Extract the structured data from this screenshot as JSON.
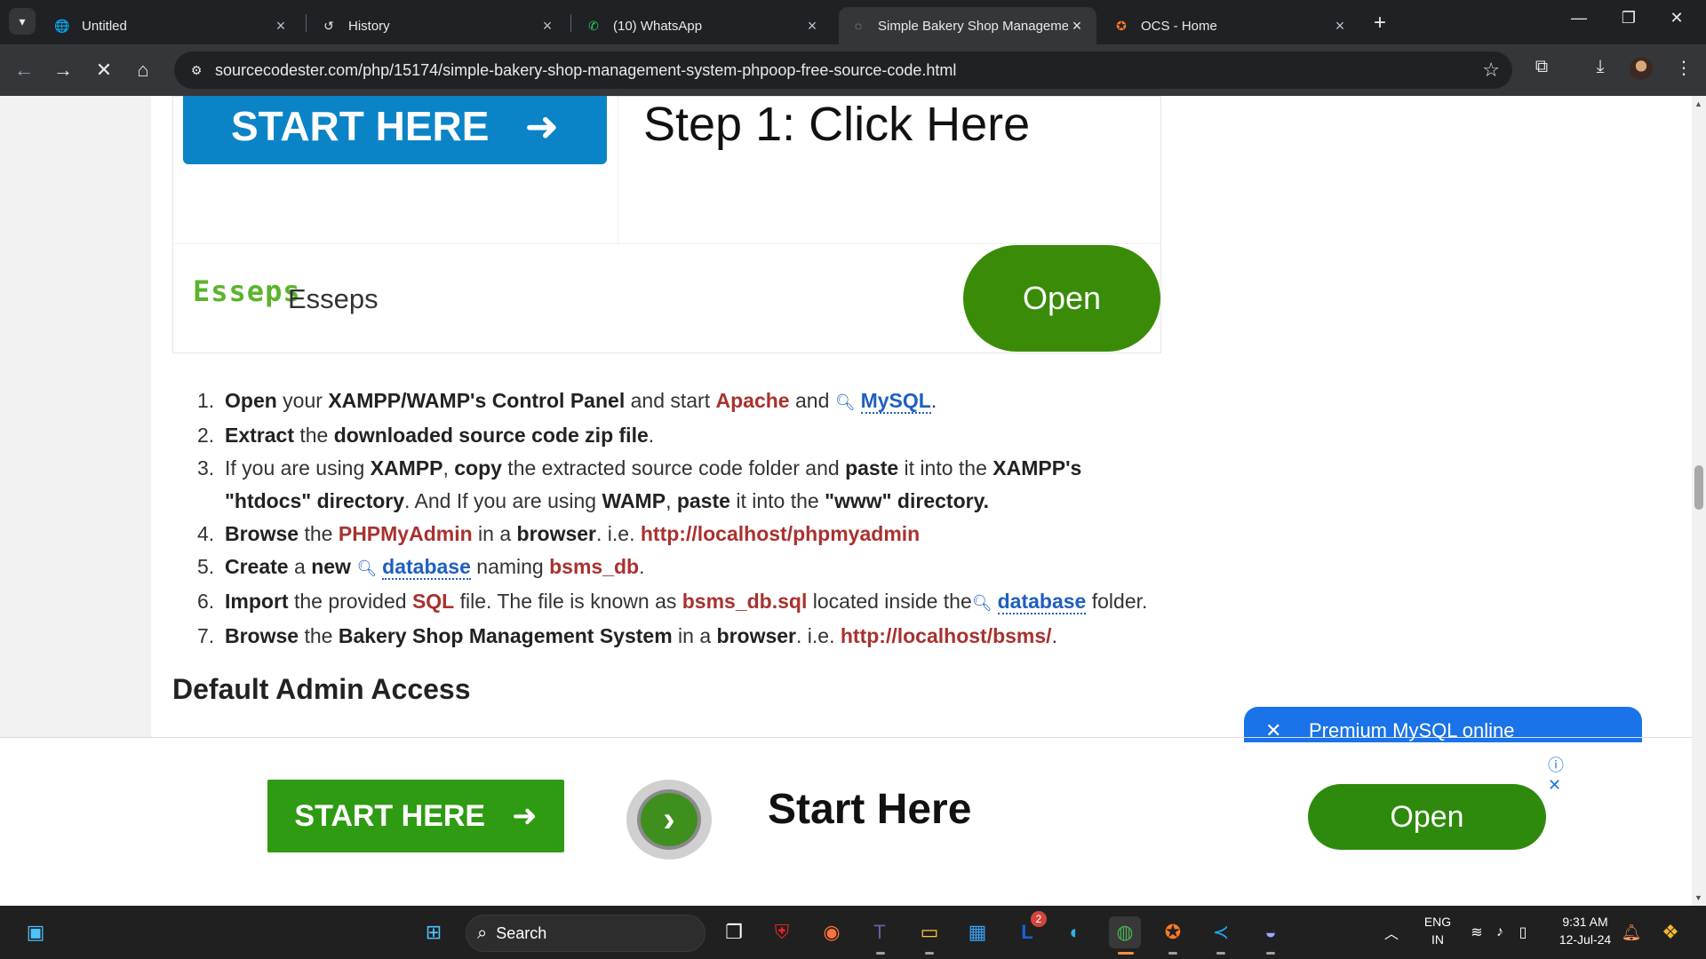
{
  "browser": {
    "tab_search_icon": "chevron-down-icon",
    "tabs": [
      {
        "label": "Untitled",
        "icon": "globe-icon"
      },
      {
        "label": "History",
        "icon": "history-icon"
      },
      {
        "label": "(10) WhatsApp",
        "icon": "whatsapp-icon"
      },
      {
        "label": "Simple Bakery Shop Manageme",
        "icon": "loading-icon",
        "active": true
      },
      {
        "label": "OCS - Home",
        "icon": "xampp-icon"
      }
    ],
    "new_tab": "+",
    "window_controls": {
      "minimize": "—",
      "restore": "❐",
      "close": "✕"
    },
    "url": "sourcecodester.com/php/15174/simple-bakery-shop-management-system-phpoop-free-source-code.html"
  },
  "ad_top": {
    "start_label": "START HERE",
    "arrow": "➜",
    "step_title": "Step 1: Click Here",
    "logo_text": "Esseps",
    "brand": "Esseps",
    "open_label": "Open"
  },
  "steps": {
    "s1": {
      "n": "1.",
      "a": "Open",
      "b": " your ",
      "c": "XAMPP/WAMP's Control Panel",
      "d": " and start ",
      "e": "Apache",
      "f": " and ",
      "g": "MySQL",
      "h": "."
    },
    "s2": {
      "n": "2.",
      "a": "Extract",
      "b": " the ",
      "c": "downloaded source code zip file",
      "d": "."
    },
    "s3": {
      "n": "3.",
      "a": "If you are using ",
      "b": "XAMPP",
      "c": ", ",
      "d": "copy",
      "e": " the extracted source code folder and ",
      "f": "paste",
      "g": " it into the ",
      "h": "XAMPP's",
      "i": "\"htdocs\" directory",
      "j": ". And If you are using ",
      "k": "WAMP",
      "l": ", ",
      "m": "paste",
      "n2": " it into the ",
      "o": "\"www\" directory."
    },
    "s4": {
      "n": "4.",
      "a": "Browse",
      "b": " the ",
      "c": "PHPMyAdmin",
      "d": " in a ",
      "e": "browser",
      "f": ". i.e. ",
      "g": "http://localhost/phpmyadmin"
    },
    "s5": {
      "n": "5.",
      "a": "Create",
      "b": " a ",
      "c": "new",
      "d": "database",
      "e": " naming ",
      "f": "bsms_db",
      "g": "."
    },
    "s6": {
      "n": "6.",
      "a": "Import",
      "b": " the provided ",
      "c": "SQL",
      "d": " file. The file is known as ",
      "e": "bsms_db.sql",
      "f": " located inside the",
      "g": "database",
      "h": " folder."
    },
    "s7": {
      "n": "7.",
      "a": "Browse",
      "b": " the ",
      "c": "Bakery Shop Management System",
      "d": " in a ",
      "e": "browser",
      "f": ". i.e. ",
      "g": "http://localhost/bsms/",
      "h": "."
    }
  },
  "section_heading": "Default Admin Access",
  "float_widget": {
    "close": "✕",
    "label": "Premium MySQL online"
  },
  "ad_bottom": {
    "start_label": "START HERE",
    "arrow": "➜",
    "title": "Start Here",
    "open_label": "Open",
    "info_icon": "ⓘ",
    "close_icon": "✕"
  },
  "taskbar": {
    "search_label": "Search",
    "tray": {
      "lang1": "ENG",
      "lang2": "IN",
      "time": "9:31 AM",
      "date": "12-Jul-24"
    },
    "badge_count": "2"
  }
}
